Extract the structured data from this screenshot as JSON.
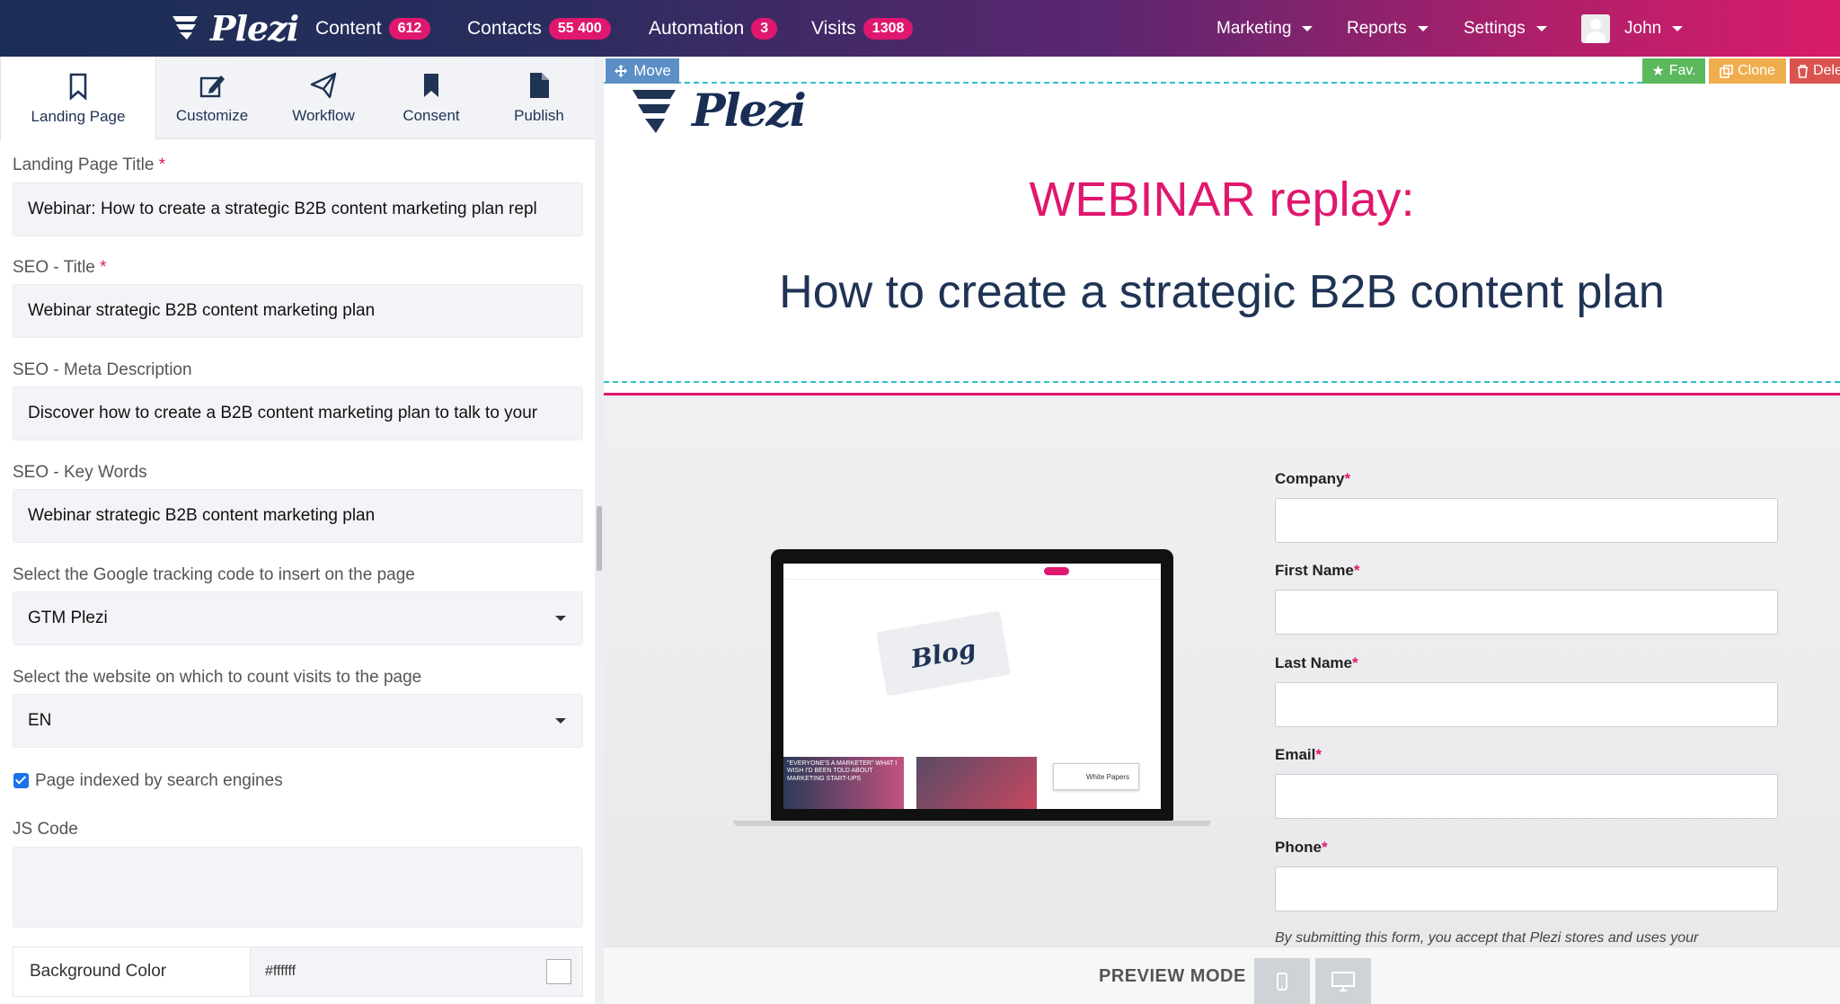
{
  "topbar": {
    "brand": "Plezi",
    "nav": [
      {
        "label": "Content",
        "count": "612"
      },
      {
        "label": "Contacts",
        "count": "55 400"
      },
      {
        "label": "Automation",
        "count": "3"
      },
      {
        "label": "Visits",
        "count": "1308"
      }
    ],
    "menus": [
      "Marketing",
      "Reports",
      "Settings"
    ],
    "user": "John"
  },
  "tabs": [
    {
      "label": "Landing Page",
      "icon": "bookmark-outline-icon"
    },
    {
      "label": "Customize",
      "icon": "edit-icon"
    },
    {
      "label": "Workflow",
      "icon": "paper-plane-icon"
    },
    {
      "label": "Consent",
      "icon": "bookmark-icon"
    },
    {
      "label": "Publish",
      "icon": "file-icon"
    }
  ],
  "form": {
    "lp_title_label": "Landing Page Title",
    "lp_title_value": "Webinar: How to create a strategic B2B content marketing plan repl",
    "seo_title_label": "SEO - Title",
    "seo_title_value": "Webinar strategic B2B content marketing plan",
    "meta_label": "SEO - Meta Description",
    "meta_value": "Discover how to create a B2B content marketing plan to talk to your",
    "keywords_label": "SEO - Key Words",
    "keywords_value": "Webinar strategic B2B content marketing plan",
    "gtm_label": "Select the Google tracking code to insert on the page",
    "gtm_value": "GTM Plezi",
    "site_label": "Select the website on which to count visits to the page",
    "site_value": "EN",
    "indexed_label": "Page indexed by search engines",
    "indexed_checked": true,
    "js_label": "JS Code",
    "js_value": "",
    "bg_label": "Background Color",
    "bg_value": "#ffffff",
    "required_mark": "*"
  },
  "preview": {
    "move_label": "Move",
    "fav_label": "Fav.",
    "clone_label": "Clone",
    "delete_label": "Dele",
    "logo_text": "Plezi",
    "webinar_heading": "WEBINAR replay:",
    "headline": "How to create a strategic B2B content plan",
    "laptop": {
      "blog_label": "Blog",
      "thumb_text": "\"EVERYONE'S A MARKETER\" WHAT I WISH I'D BEEN TOLD ABOUT MARKETING START-UPS",
      "white_papers": "White Papers"
    },
    "form_fields": [
      {
        "label": "Company",
        "required": "*"
      },
      {
        "label": "First Name",
        "required": "*"
      },
      {
        "label": "Last Name",
        "required": "*"
      },
      {
        "label": "Email",
        "required": "*"
      },
      {
        "label": "Phone",
        "required": "*"
      }
    ],
    "consent_text": "By submitting this form, you accept that Plezi stores and uses your"
  },
  "preview_bar": {
    "label": "PREVIEW MODE",
    "mobile_icon": "mobile-icon",
    "desktop_icon": "desktop-icon"
  },
  "colors": {
    "brand_pink": "#e0176e",
    "navy": "#1f3354",
    "accent_teal": "#2ec1c7"
  }
}
